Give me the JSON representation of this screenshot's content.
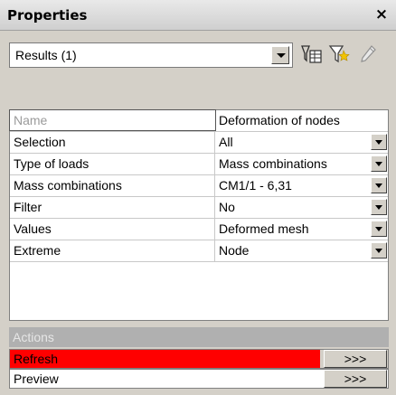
{
  "panel": {
    "title": "Properties",
    "close_glyph": "×"
  },
  "selector": {
    "value": "Results (1)"
  },
  "toolbar": {
    "icons": [
      "table-filter-icon",
      "filter-icon",
      "pencil-icon"
    ]
  },
  "grid": {
    "header": {
      "name": "Name",
      "value": "Deformation of nodes"
    },
    "rows": [
      {
        "name": "Selection",
        "value": "All"
      },
      {
        "name": "Type of loads",
        "value": "Mass combinations"
      },
      {
        "name": "Mass combinations",
        "value": "CM1/1 - 6,31"
      },
      {
        "name": "Filter",
        "value": "No"
      },
      {
        "name": "Values",
        "value": "Deformed mesh"
      },
      {
        "name": "Extreme",
        "value": "Node"
      }
    ]
  },
  "actions": {
    "header": "Actions",
    "items": [
      {
        "label": "Refresh",
        "button": ">>>",
        "highlight": "#ff0000"
      },
      {
        "label": "Preview",
        "button": ">>>"
      }
    ]
  }
}
